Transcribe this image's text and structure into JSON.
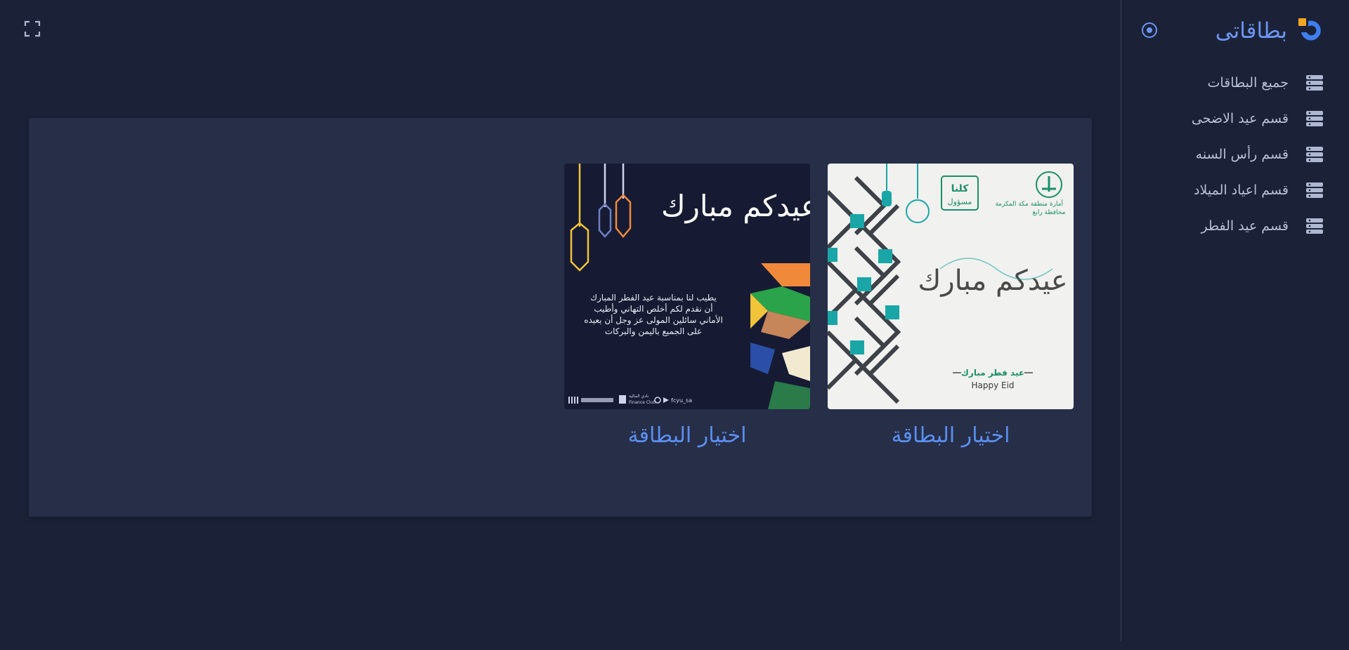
{
  "sidebar": {
    "brand_name": "بطاقاتى",
    "items": [
      {
        "label": "جميع البطاقات"
      },
      {
        "label": "قسم عيد الاضحى"
      },
      {
        "label": "قسم رأس السنه"
      },
      {
        "label": "قسم اعياد الميلاد"
      },
      {
        "label": "قسم عيد الفطر"
      }
    ]
  },
  "cards": [
    {
      "button_label": "اختيار البطاقة",
      "image": {
        "org_line1": "أمارة منطقة مكة المكرمة",
        "org_line2": "محافظة رابغ",
        "badge_line1": "كلنا",
        "badge_line2": "مسؤول",
        "greeting": "عيدكم مبارك",
        "subtitle_ar": "عيد فطر مبارك",
        "subtitle_en": "Happy Eid"
      }
    },
    {
      "button_label": "اختيار البطاقة",
      "image": {
        "greeting": "عيدكم مبارك",
        "line1": "يطيب لنا بمناسبة عيد الفطر المبارك",
        "line2": "أن نقدم لكم أخلص التهاني وأطيب",
        "line3": "الأماني سائلين المولى عز وجل أن يعيده",
        "line4": "على الجميع باليمن والبركات",
        "footer_handle": "fcyu_sa",
        "footer_club": "Finance Club"
      }
    }
  ],
  "colors": {
    "background": "#1b2238",
    "panel": "#262e48",
    "accent": "#5b8ff0",
    "logo_orange": "#f5a524"
  }
}
